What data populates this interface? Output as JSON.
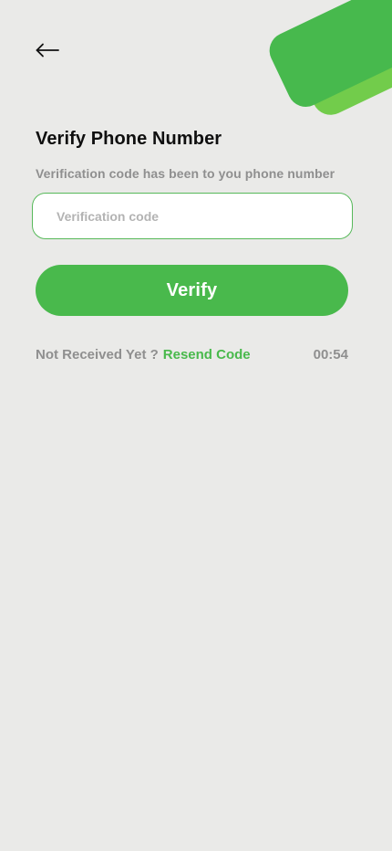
{
  "header": {
    "back_icon": "arrow-left-icon"
  },
  "verify": {
    "title": "Verify Phone Number",
    "subtitle": "Verification code has been to you phone number",
    "input_value": "",
    "input_placeholder": "Verification code",
    "button_label": "Verify"
  },
  "resend": {
    "prompt": "Not Received Yet ?",
    "link_label": "Resend Code",
    "timer": "00:54"
  },
  "colors": {
    "background": "#eaeae8",
    "accent": "#49b94c",
    "accent_light": "#72cc4b",
    "muted_text": "#8f8f8f",
    "title_text": "#0f0f0f",
    "input_border": "#57b95a"
  }
}
